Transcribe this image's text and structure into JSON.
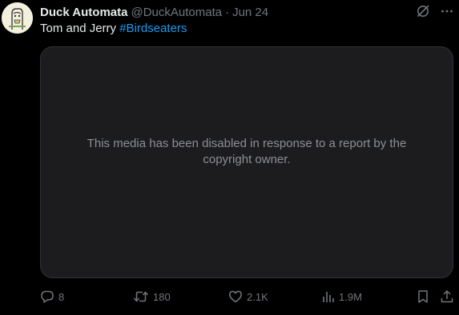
{
  "tweet": {
    "display_name": "Duck Automata",
    "handle": "@DuckAutomata",
    "separator": "·",
    "date": "Jun 24",
    "text": "Tom and Jerry",
    "hashtag": "#Birdseaters"
  },
  "media": {
    "notice": "This media has been disabled in response to a report by the copyright owner."
  },
  "actions": {
    "replies": "8",
    "reposts": "180",
    "likes": "2.1K",
    "views": "1.9M"
  },
  "colors": {
    "background": "#000000",
    "text_primary": "#e7e9ea",
    "text_secondary": "#71767b",
    "accent": "#1d9bf0",
    "media_background": "#1c1c1f",
    "border": "#2f3336"
  },
  "icons": {
    "header": [
      "grok-icon",
      "more-icon"
    ],
    "actions": [
      "reply-icon",
      "repost-icon",
      "like-icon",
      "views-icon",
      "bookmark-icon",
      "share-icon"
    ]
  }
}
